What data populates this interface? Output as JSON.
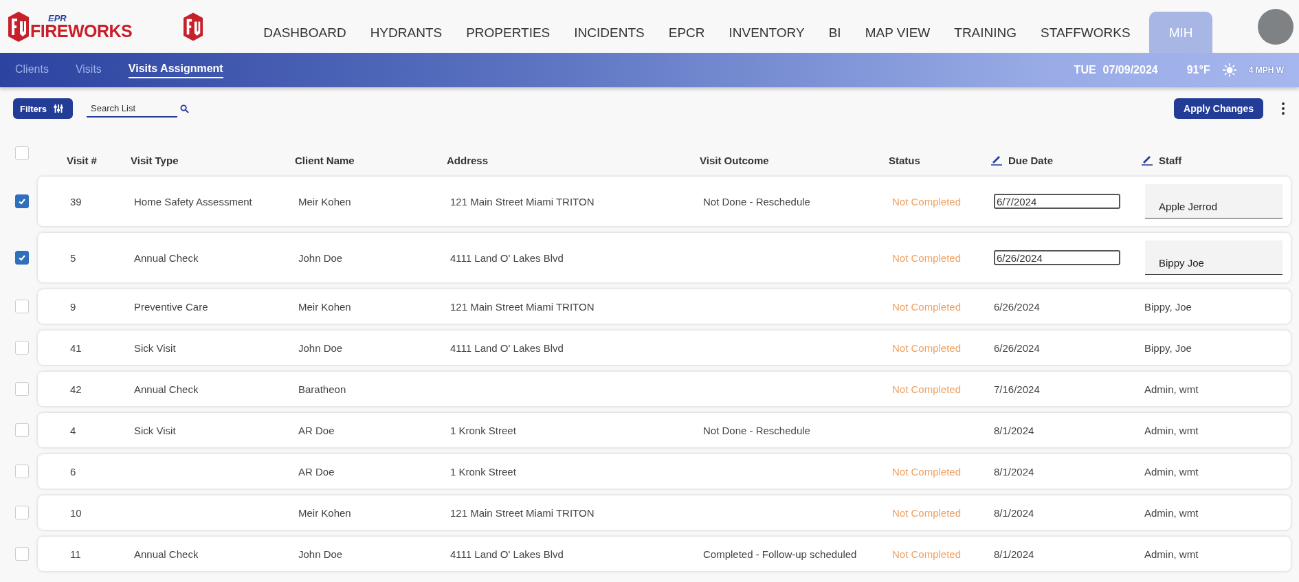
{
  "brand": {
    "small": "EPR",
    "name": "FIREWORKS"
  },
  "nav": [
    {
      "label": "DASHBOARD",
      "selected": false
    },
    {
      "label": "HYDRANTS",
      "selected": false
    },
    {
      "label": "PROPERTIES",
      "selected": false
    },
    {
      "label": "INCIDENTS",
      "selected": false
    },
    {
      "label": "EPCR",
      "selected": false
    },
    {
      "label": "INVENTORY",
      "selected": false
    },
    {
      "label": "BI",
      "selected": false
    },
    {
      "label": "MAP VIEW",
      "selected": false
    },
    {
      "label": "TRAINING",
      "selected": false
    },
    {
      "label": "STAFFWORKS",
      "selected": false
    },
    {
      "label": "MIH",
      "selected": true
    }
  ],
  "subnav": [
    {
      "label": "Clients",
      "selected": false
    },
    {
      "label": "Visits",
      "selected": false
    },
    {
      "label": "Visits Assignment",
      "selected": true
    }
  ],
  "weather": {
    "day": "TUE",
    "date": "07/09/2024",
    "temperature": "91°F",
    "wind": "4 MPH W"
  },
  "toolbar": {
    "filters": "Filters",
    "search": {
      "placeholder": "Search List"
    },
    "apply": "Apply Changes"
  },
  "table": {
    "select_all": {
      "checked": false
    },
    "columns": [
      {
        "label": "Visit #",
        "editable": false
      },
      {
        "label": "Visit Type",
        "editable": false
      },
      {
        "label": "Client Name",
        "editable": false
      },
      {
        "label": "Address",
        "editable": false
      },
      {
        "label": "Visit Outcome",
        "editable": false
      },
      {
        "label": "Status",
        "editable": false
      },
      {
        "label": "Due Date",
        "editable": true
      },
      {
        "label": "Staff",
        "editable": true
      }
    ],
    "rows": [
      {
        "kind": "editing",
        "checked": true,
        "visit": "39",
        "type": "Home Safety Assessment",
        "client": "Meir Kohen",
        "address": "121 Main Street Miami TRITON",
        "outcome": "Not Done - Reschedule",
        "status": "Not Completed",
        "due": "6/7/2024",
        "staff": "Apple Jerrod"
      },
      {
        "kind": "editing",
        "checked": true,
        "visit": "5",
        "type": "Annual Check",
        "client": "John Doe",
        "address": "4111 Land O' Lakes Blvd",
        "outcome": "",
        "status": "Not Completed",
        "due": "6/26/2024",
        "staff": "Bippy Joe"
      },
      {
        "kind": "plain",
        "checked": false,
        "visit": "9",
        "type": "Preventive Care",
        "client": "Meir Kohen",
        "address": "121 Main Street Miami TRITON",
        "outcome": "",
        "status": "Not Completed",
        "due": "6/26/2024",
        "staff": "Bippy, Joe"
      },
      {
        "kind": "plain",
        "checked": false,
        "visit": "41",
        "type": "Sick Visit",
        "client": "John Doe",
        "address": "4111 Land O' Lakes Blvd",
        "outcome": "",
        "status": "Not Completed",
        "due": "6/26/2024",
        "staff": "Bippy, Joe"
      },
      {
        "kind": "plain",
        "checked": false,
        "visit": "42",
        "type": "Annual Check",
        "client": "Baratheon",
        "address": "",
        "outcome": "",
        "status": "Not Completed",
        "due": "7/16/2024",
        "staff": "Admin, wmt"
      },
      {
        "kind": "plain",
        "checked": false,
        "visit": "4",
        "type": "Sick Visit",
        "client": "AR Doe",
        "address": "1 Kronk Street",
        "outcome": "Not Done - Reschedule",
        "status": "",
        "due": "8/1/2024",
        "staff": "Admin, wmt"
      },
      {
        "kind": "plain",
        "checked": false,
        "visit": "6",
        "type": "",
        "client": "AR Doe",
        "address": "1 Kronk Street",
        "outcome": "",
        "status": "Not Completed",
        "due": "8/1/2024",
        "staff": "Admin, wmt"
      },
      {
        "kind": "plain",
        "checked": false,
        "visit": "10",
        "type": "",
        "client": "Meir Kohen",
        "address": "121 Main Street Miami TRITON",
        "outcome": "",
        "status": "Not Completed",
        "due": "8/1/2024",
        "staff": "Admin, wmt"
      },
      {
        "kind": "plain",
        "checked": false,
        "visit": "11",
        "type": "Annual Check",
        "client": "John Doe",
        "address": "4111 Land O' Lakes Blvd",
        "outcome": "Completed - Follow-up scheduled",
        "status": "Not Completed",
        "due": "8/1/2024",
        "staff": "Admin, wmt"
      }
    ]
  }
}
